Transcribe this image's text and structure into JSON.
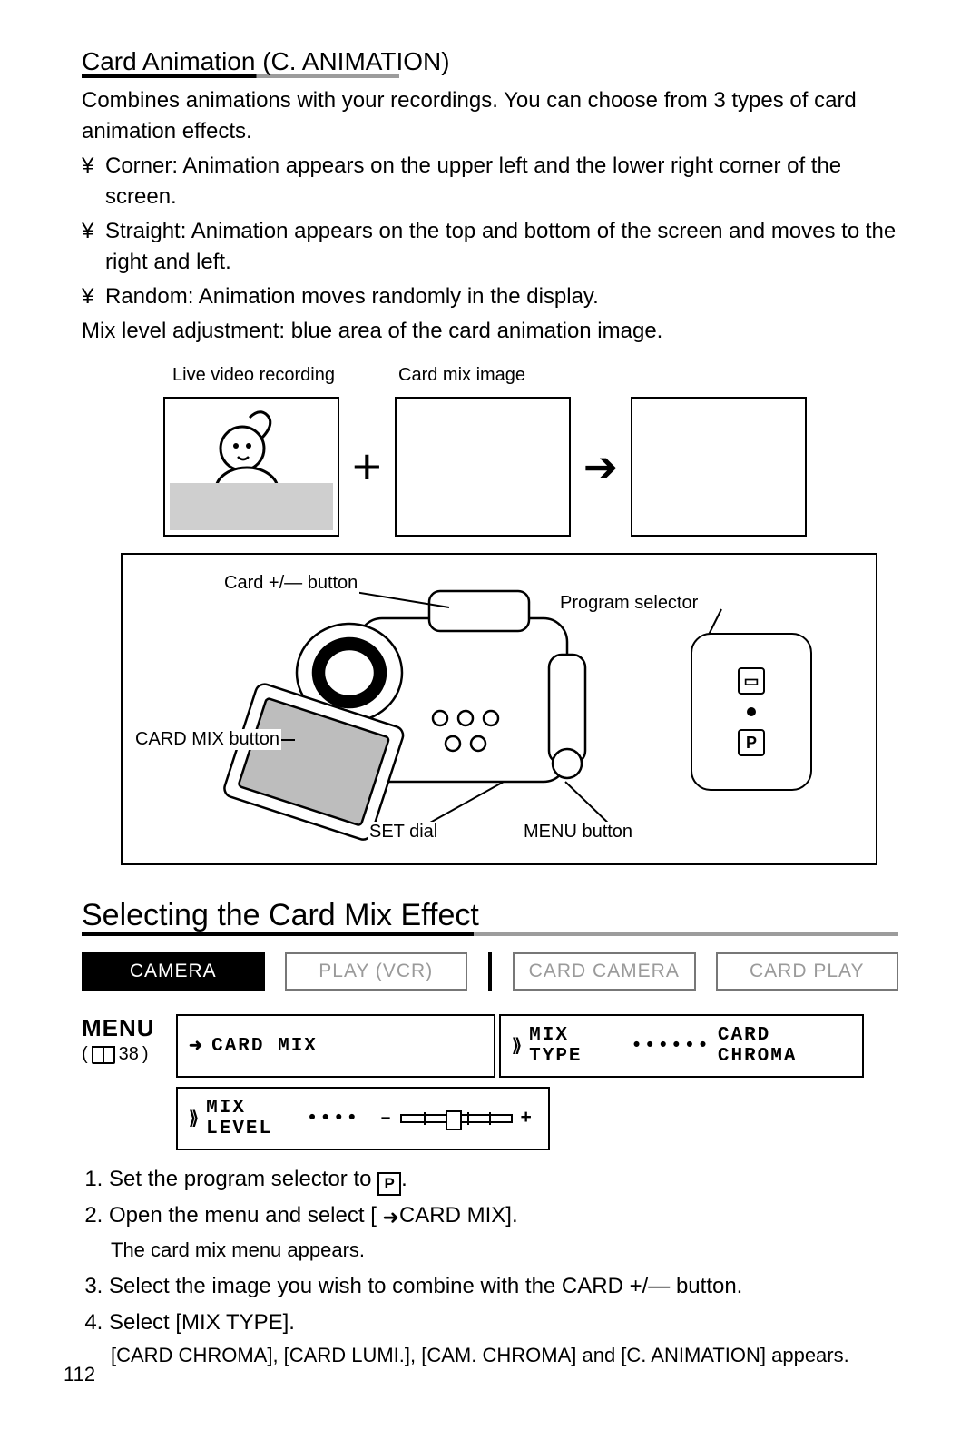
{
  "sections": {
    "card_animation": {
      "heading": "Card Animation (C. ANIMATION)",
      "intro": "Combines animations with your recordings. You can choose from 3 types of card animation effects.",
      "bullets": [
        "Corner: Animation appears on the upper left and the lower right corner of the screen.",
        "Straight: Animation appears on the top and bottom of the screen and moves to the right and left.",
        "Random: Animation moves randomly in the display."
      ],
      "mix_note": "Mix level adjustment: blue area of the card animation image.",
      "tile_labels": {
        "live": "Live video recording",
        "mix": "Card mix image"
      }
    },
    "camera_diagram": {
      "labels": {
        "card_btn": "Card +/— button",
        "cardmix_btn": "CARD MIX button",
        "set_dial": "SET dial",
        "menu_btn": "MENU button",
        "program_sel": "Program selector"
      }
    },
    "select_effect": {
      "heading": "Selecting the Card Mix Effect",
      "tabs": [
        "CAMERA",
        "PLAY (VCR)",
        "CARD CAMERA",
        "CARD PLAY"
      ],
      "menu": {
        "title": "MENU",
        "page_ref": "38",
        "box_cardmix": "CARD MIX",
        "box_mixtype_label": "MIX TYPE",
        "box_mixtype_dots": "••••••",
        "box_mixtype_value": "CARD CHROMA",
        "box_mixlevel_label": "MIX LEVEL",
        "box_mixlevel_dots": "••••"
      },
      "steps": [
        {
          "text_before": "Set the program selector to ",
          "icon": "p-icon",
          "text_after": "."
        },
        {
          "text_before": "Open the menu and select [",
          "icon": "arrow",
          "text_after": "CARD MIX].",
          "sub": "The card mix menu appears."
        },
        {
          "text_before": "Select the image you wish to combine with the CARD +/— button."
        },
        {
          "text_before": "Select [MIX TYPE].",
          "sub": "[CARD CHROMA], [CARD LUMI.], [CAM. CHROMA] and [C. ANIMATION] appears."
        }
      ]
    }
  },
  "page_number": "112"
}
